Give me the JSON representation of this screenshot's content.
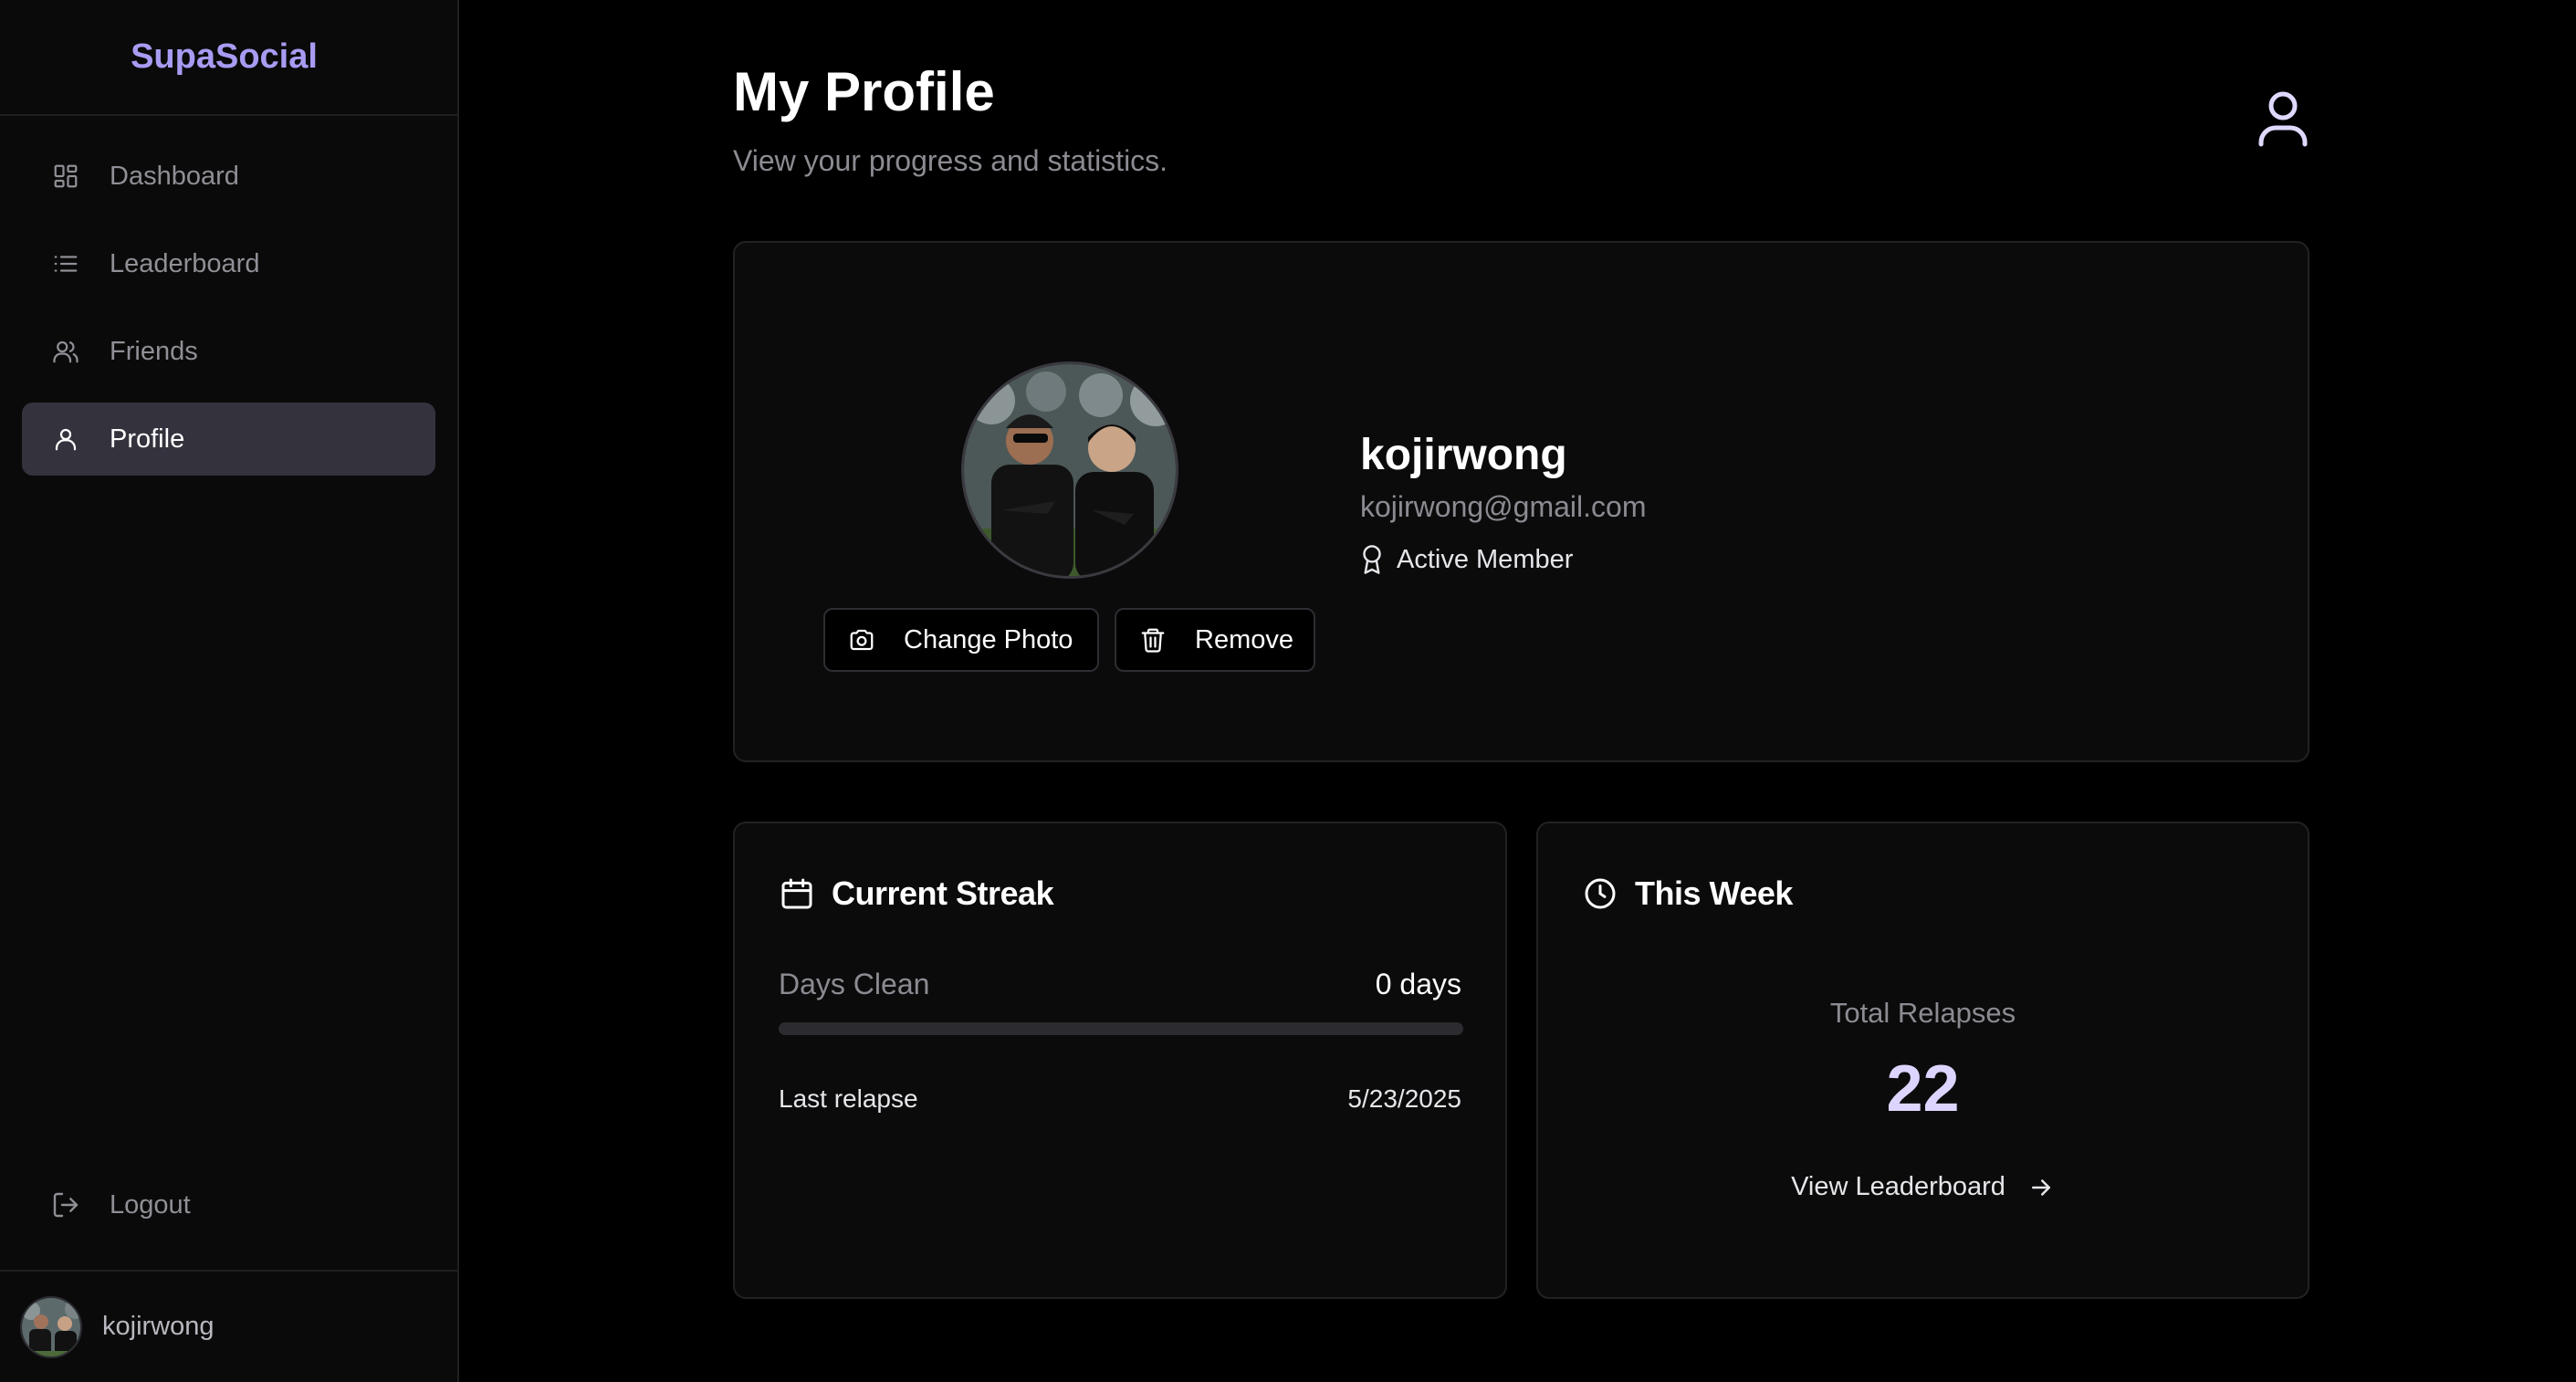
{
  "sidebar": {
    "brand": "SupaSocial",
    "items": [
      {
        "label": "Dashboard",
        "icon": "grid-icon"
      },
      {
        "label": "Leaderboard",
        "icon": "list-icon"
      },
      {
        "label": "Friends",
        "icon": "users-icon"
      },
      {
        "label": "Profile",
        "icon": "user-icon",
        "active": true
      }
    ],
    "logout_label": "Logout",
    "username": "kojirwong"
  },
  "header": {
    "title": "My Profile",
    "subtitle": "View your progress and statistics."
  },
  "profile": {
    "name": "kojirwong",
    "email": "kojirwong@gmail.com",
    "badge": "Active Member",
    "change_photo_label": "Change Photo",
    "remove_label": "Remove"
  },
  "streak": {
    "title": "Current Streak",
    "days_label": "Days Clean",
    "days_value": "0 days",
    "progress_fraction": 0,
    "last_relapse_label": "Last relapse",
    "last_relapse_value": "5/23/2025"
  },
  "week": {
    "title": "This Week",
    "total_label": "Total Relapses",
    "total_value": "22",
    "link_label": "View Leaderboard"
  },
  "colors": {
    "accent": "#a79cf2",
    "accent_light": "#ddd5ff",
    "background": "#000000",
    "card": "#0b0b0c",
    "active_nav": "#34323d"
  }
}
